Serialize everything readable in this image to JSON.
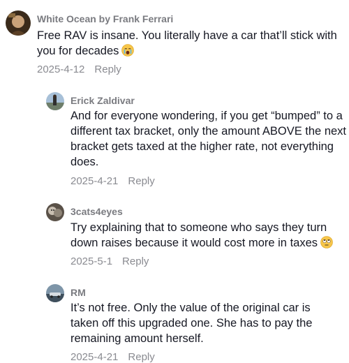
{
  "comments": [
    {
      "author": "White Ocean by Frank Ferrari",
      "text": "Free RAV is insane. You literally have a car that’ll stick with you for decades",
      "emoji": "crying-face",
      "date": "2025-4-12",
      "reply": "Reply"
    },
    {
      "author": "Erick Zaldivar",
      "text": "And for everyone wondering, if you get “bumped” to a different tax bracket, only the amount ABOVE the next bracket gets taxed at the higher rate, not everything does.",
      "date": "2025-4-21",
      "reply": "Reply"
    },
    {
      "author": "3cats4eyes",
      "text": "Try explaining that to someone who says they turn down raises because it would cost more in taxes",
      "emoji": "eye-roll-face",
      "date": "2025-5-1",
      "reply": "Reply"
    },
    {
      "author": "RM",
      "text": "It’s not free. Only the value of the original car is taken off this upgraded one. She has to pay the remaining amount herself.",
      "date": "2025-4-21",
      "reply": "Reply"
    }
  ],
  "colors": {
    "text": "#161823",
    "author": "#7a7b80",
    "meta": "#8a8b91"
  }
}
